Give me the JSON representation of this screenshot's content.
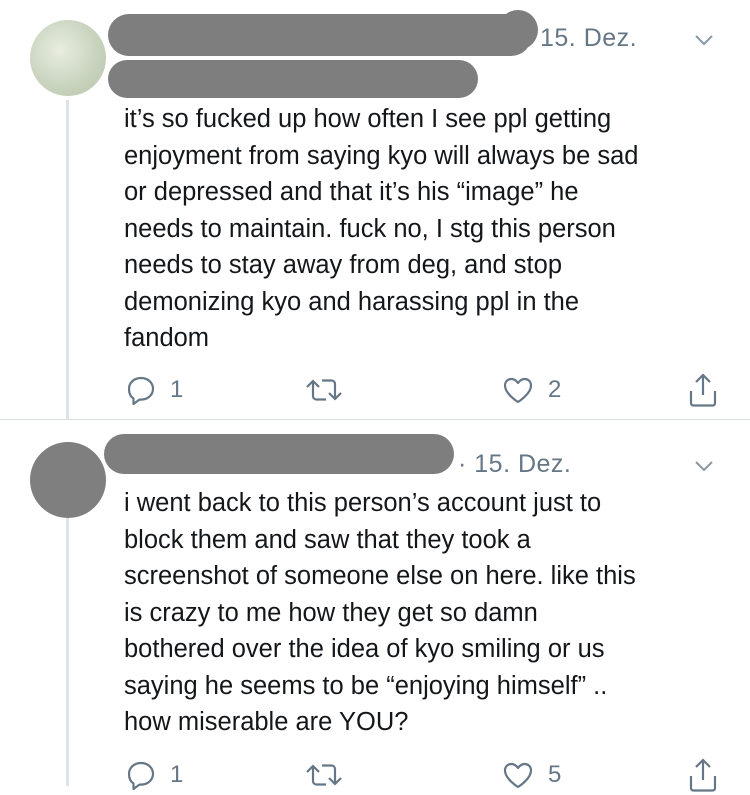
{
  "tweets": [
    {
      "date": "15. Dez.",
      "text": "it’s so fucked up how often I see ppl getting\nenjoyment from saying kyo will always be sad\nor depressed and that it’s his “image” he\nneeds to maintain. fuck no, I stg this person\nneeds to stay away from deg, and stop\ndemonizing kyo and harassing ppl in the\nfandom",
      "reply_count": "1",
      "retweet_count": "",
      "like_count": "2"
    },
    {
      "date": "· 15. Dez.",
      "text": "i went back to this person’s account just to\nblock them and saw that they took a\nscreenshot of someone else on here. like this\nis crazy to me how they get so damn\nbothered over the idea of kyo smiling or us\nsaying he seems to be “enjoying himself” ..\nhow miserable are YOU?",
      "reply_count": "1",
      "retweet_count": "",
      "like_count": "5"
    }
  ],
  "icons": {
    "reply": "reply-icon",
    "retweet": "retweet-icon",
    "like": "heart-icon",
    "share": "share-icon",
    "menu": "chevron-down-icon"
  },
  "colors": {
    "text": "#14171a",
    "secondary": "#657786",
    "redaction": "#7e7e7e",
    "thread_line": "#dde3e8"
  }
}
